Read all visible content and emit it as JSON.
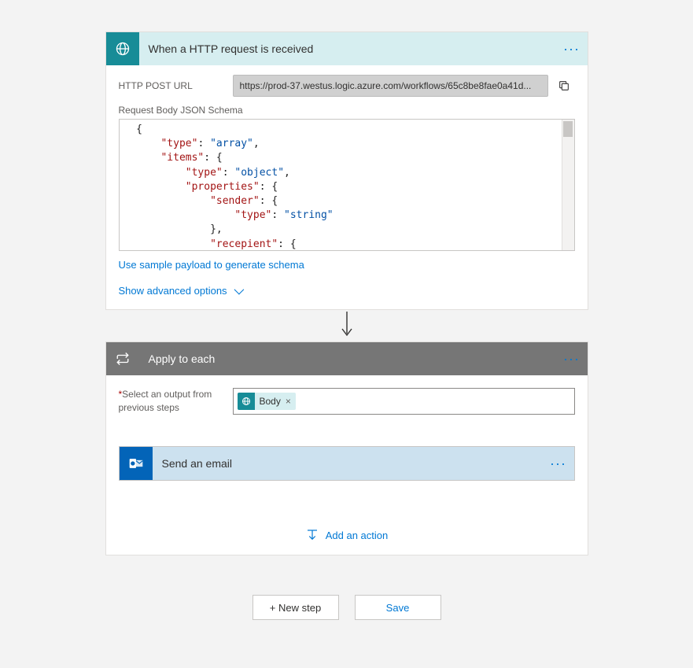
{
  "http_card": {
    "title": "When a HTTP request is received",
    "url_label": "HTTP POST URL",
    "url_value": "https://prod-37.westus.logic.azure.com/workflows/65c8be8fae0a41d...",
    "schema_label": "Request Body JSON Schema",
    "sample_link": "Use sample payload to generate schema",
    "advanced_link": "Show advanced options",
    "schema_lines": [
      {
        "indent": 0,
        "parts": [
          {
            "t": "brace",
            "v": "{"
          }
        ]
      },
      {
        "indent": 2,
        "parts": [
          {
            "t": "key",
            "v": "\"type\""
          },
          {
            "t": "punc",
            "v": ": "
          },
          {
            "t": "str",
            "v": "\"array\""
          },
          {
            "t": "punc",
            "v": ","
          }
        ]
      },
      {
        "indent": 2,
        "parts": [
          {
            "t": "key",
            "v": "\"items\""
          },
          {
            "t": "punc",
            "v": ": {"
          }
        ]
      },
      {
        "indent": 4,
        "parts": [
          {
            "t": "key",
            "v": "\"type\""
          },
          {
            "t": "punc",
            "v": ": "
          },
          {
            "t": "str",
            "v": "\"object\""
          },
          {
            "t": "punc",
            "v": ","
          }
        ]
      },
      {
        "indent": 4,
        "parts": [
          {
            "t": "key",
            "v": "\"properties\""
          },
          {
            "t": "punc",
            "v": ": {"
          }
        ]
      },
      {
        "indent": 6,
        "parts": [
          {
            "t": "key",
            "v": "\"sender\""
          },
          {
            "t": "punc",
            "v": ": {"
          }
        ]
      },
      {
        "indent": 8,
        "parts": [
          {
            "t": "key",
            "v": "\"type\""
          },
          {
            "t": "punc",
            "v": ": "
          },
          {
            "t": "str",
            "v": "\"string\""
          }
        ]
      },
      {
        "indent": 6,
        "parts": [
          {
            "t": "punc",
            "v": "},"
          }
        ]
      },
      {
        "indent": 6,
        "parts": [
          {
            "t": "key",
            "v": "\"recepient\""
          },
          {
            "t": "punc",
            "v": ": {"
          }
        ]
      }
    ]
  },
  "apply_card": {
    "title": "Apply to each",
    "select_label_pre": "*",
    "select_label": "Select an output from previous steps",
    "token_label": "Body"
  },
  "send_card": {
    "title": "Send an email"
  },
  "add_action": "Add an action",
  "footer": {
    "new_step": "+ New step",
    "save": "Save"
  }
}
